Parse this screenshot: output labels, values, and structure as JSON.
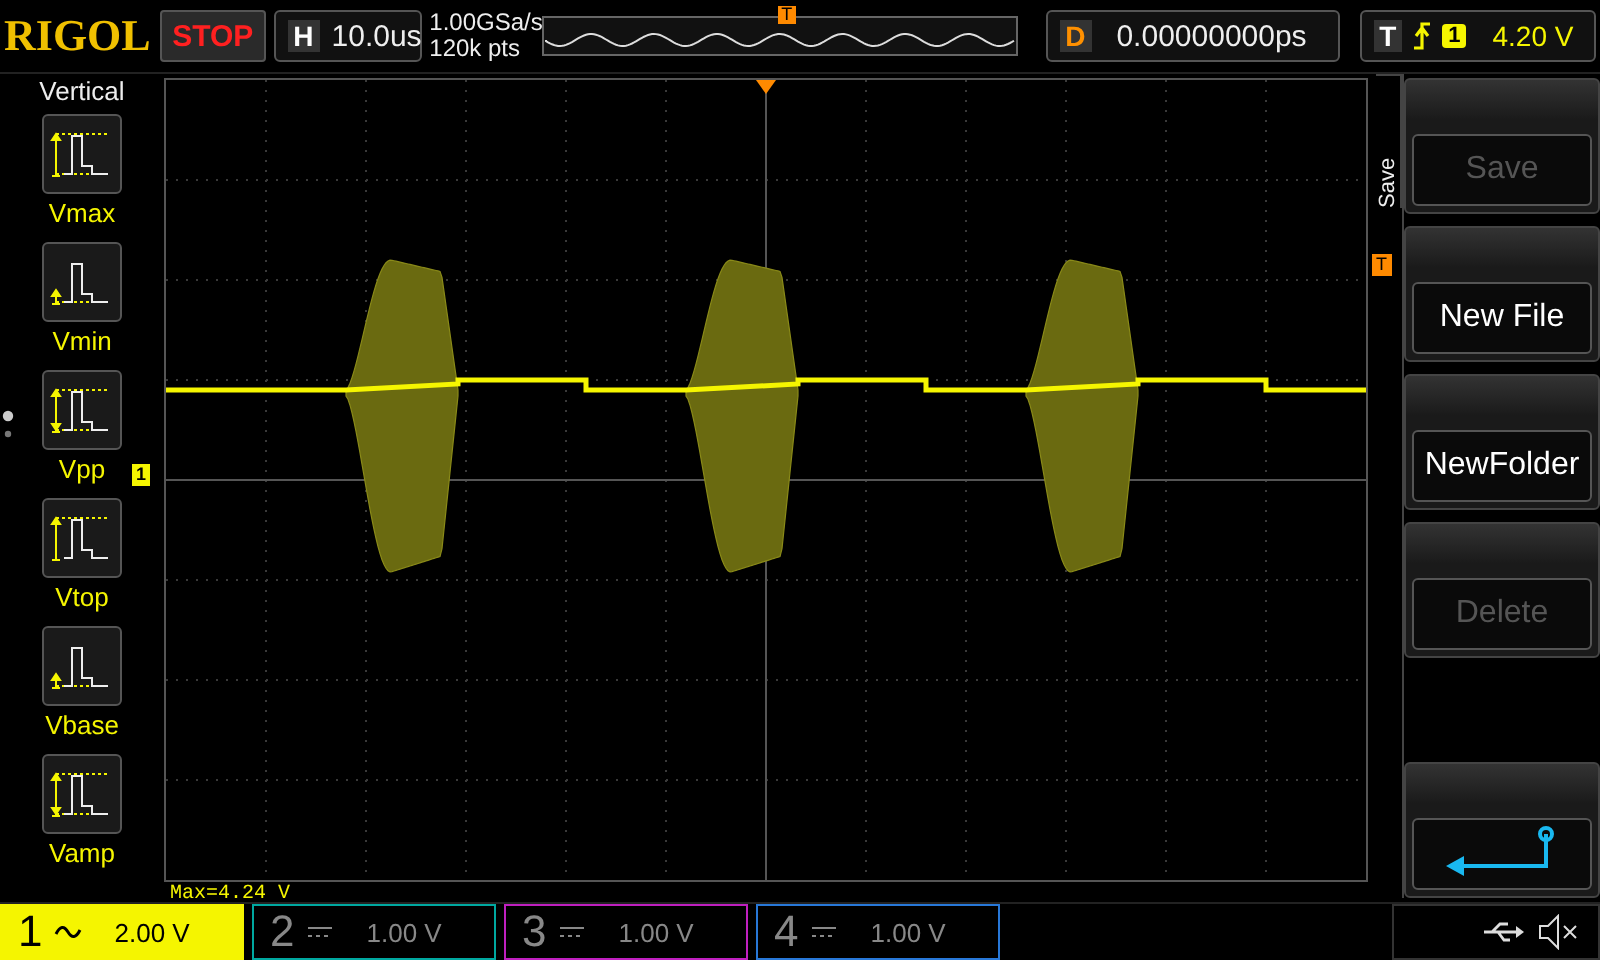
{
  "top_bar": {
    "brand": "RIGOL",
    "run_state": "STOP",
    "horizontal": {
      "label": "H",
      "timebase": "10.0us"
    },
    "sample_rate": "1.00GSa/s",
    "memory_depth": "120k pts",
    "overview_marker": "T",
    "delay": {
      "label": "D",
      "value": "0.00000000ps"
    },
    "trigger": {
      "label": "T",
      "channel": "1",
      "level": "4.20 V"
    }
  },
  "left_menu": {
    "title": "Vertical",
    "items": [
      {
        "label": "Vmax",
        "kind": "max"
      },
      {
        "label": "Vmin",
        "kind": "min"
      },
      {
        "label": "Vpp",
        "kind": "pp"
      },
      {
        "label": "Vtop",
        "kind": "top"
      },
      {
        "label": "Vbase",
        "kind": "base"
      },
      {
        "label": "Vamp",
        "kind": "amp"
      }
    ]
  },
  "screen": {
    "channel_marker": "1",
    "trigger_level_marker": "T",
    "measurement": "Max=4.24 V"
  },
  "right_menu": {
    "tab": "Save",
    "buttons": [
      {
        "kind": "text",
        "label": "Save",
        "disabled": true
      },
      {
        "kind": "text",
        "label": "New File",
        "disabled": false
      },
      {
        "kind": "text",
        "label": "NewFolder",
        "disabled": false
      },
      {
        "kind": "text",
        "label": "Delete",
        "disabled": true
      },
      {
        "kind": "back"
      }
    ]
  },
  "channels": [
    {
      "number": "1",
      "kind": "ac",
      "scale": "2.00 V",
      "active": true,
      "color": "#f5f500"
    },
    {
      "number": "2",
      "kind": "dc",
      "scale": "1.00 V",
      "active": false,
      "color": "#00a8a0"
    },
    {
      "number": "3",
      "kind": "dc",
      "scale": "1.00 V",
      "active": false,
      "color": "#c020c0"
    },
    {
      "number": "4",
      "kind": "dc",
      "scale": "1.00 V",
      "active": false,
      "color": "#2878d8"
    }
  ]
}
